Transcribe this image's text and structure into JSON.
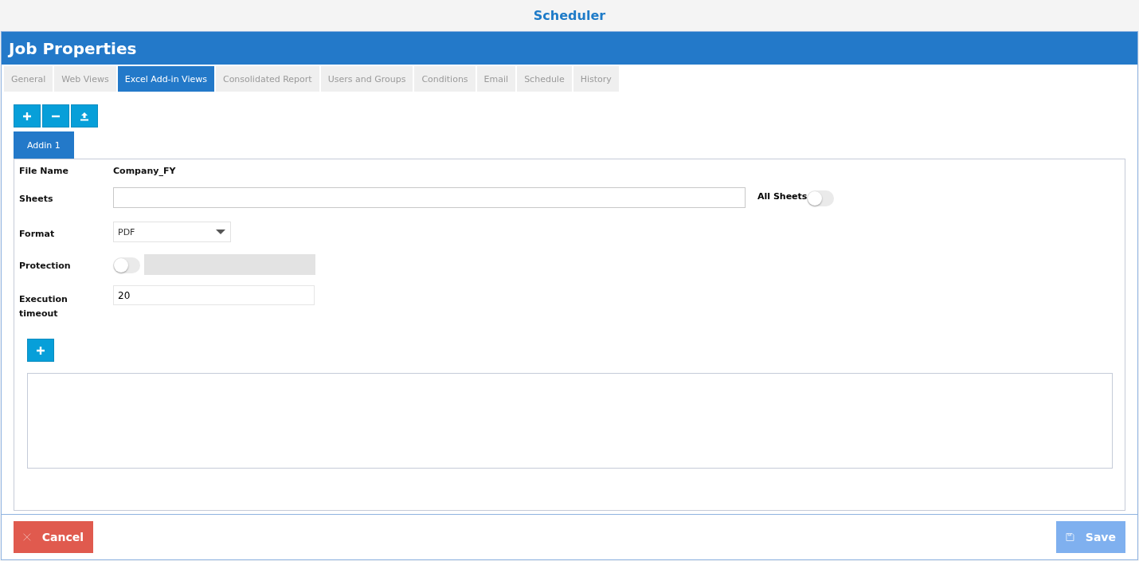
{
  "app_title": "Scheduler",
  "dialog": {
    "title": "Job Properties"
  },
  "tabs": [
    {
      "label": "General",
      "selected": false
    },
    {
      "label": "Web Views",
      "selected": false
    },
    {
      "label": "Excel Add-in Views",
      "selected": true
    },
    {
      "label": "Consolidated Report",
      "selected": false
    },
    {
      "label": "Users and Groups",
      "selected": false
    },
    {
      "label": "Conditions",
      "selected": false
    },
    {
      "label": "Email",
      "selected": false
    },
    {
      "label": "Schedule",
      "selected": false
    },
    {
      "label": "History",
      "selected": false
    }
  ],
  "toolbar": [
    {
      "kind": "add"
    },
    {
      "kind": "remove"
    },
    {
      "kind": "upload"
    }
  ],
  "addin_tabs": [
    {
      "label": "Addin 1",
      "selected": true
    }
  ],
  "form": {
    "file_name": {
      "label": "File Name",
      "value": "Company_FY"
    },
    "sheets": {
      "label": "Sheets",
      "all_sheets_label": "All Sheets",
      "all_sheets_on": false
    },
    "format": {
      "label": "Format",
      "value": "PDF"
    },
    "protection": {
      "label": "Protection",
      "on": false
    },
    "execution_timeout": {
      "label": "Execution timeout",
      "value": "20"
    }
  },
  "footer": {
    "cancel": {
      "label": "Cancel"
    },
    "save": {
      "label": "Save",
      "disabled": true
    }
  }
}
